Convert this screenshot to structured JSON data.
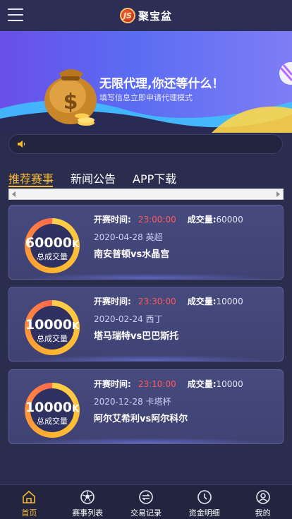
{
  "header": {
    "logo_mark": "JS",
    "logo_text": "聚宝盆"
  },
  "banner": {
    "title": "无限代理,你还等什么！",
    "subtitle": "填写信息立即申请代理模式"
  },
  "tabs": [
    {
      "label": "推荐赛事",
      "active": true
    },
    {
      "label": "新闻公告",
      "active": false
    },
    {
      "label": "APP下载",
      "active": false
    }
  ],
  "match_labels": {
    "start_time": "开赛时间:",
    "volume": "成交量:",
    "total_volume": "总成交量"
  },
  "matches": [
    {
      "total": "60000",
      "unit": "K",
      "start_time": "23:00:00",
      "volume": "60000",
      "date_league": "2020-04-28 英超",
      "teams": "南安普顿vs水晶宫"
    },
    {
      "total": "10000",
      "unit": "K",
      "start_time": "23:30:00",
      "volume": "10000",
      "date_league": "2020-02-24 西丁",
      "teams": "塔马瑞特vs巴巴斯托"
    },
    {
      "total": "10000",
      "unit": "K",
      "start_time": "23:10:00",
      "volume": "10000",
      "date_league": "2020-12-28 卡塔杯",
      "teams": "阿尔艾希利vs阿尔科尔"
    }
  ],
  "bottom_nav": [
    {
      "label": "首页",
      "icon": "home-icon",
      "active": true
    },
    {
      "label": "赛事列表",
      "icon": "soccer-ball-icon",
      "active": false
    },
    {
      "label": "交易记录",
      "icon": "exchange-icon",
      "active": false
    },
    {
      "label": "资金明细",
      "icon": "clock-icon",
      "active": false
    },
    {
      "label": "我的",
      "icon": "user-icon",
      "active": false
    }
  ],
  "colors": {
    "accent": "#f5b932",
    "time_red": "#ff5a5a",
    "background": "#2b2d4f"
  }
}
